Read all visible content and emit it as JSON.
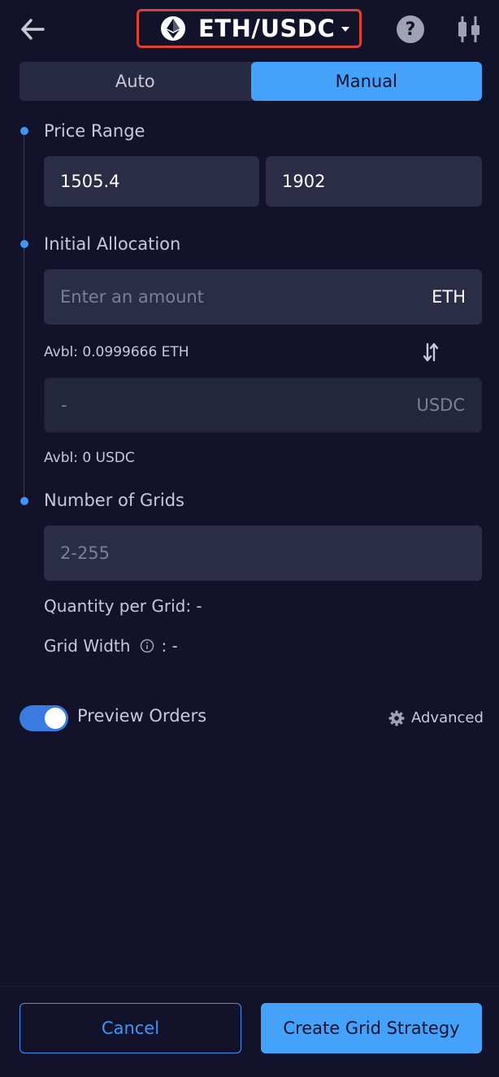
{
  "header": {
    "pair": "ETH/USDC",
    "back_icon": "arrow-left-icon",
    "help_glyph": "?",
    "chart_icon": "candlestick-icon"
  },
  "tabs": [
    {
      "label": "Auto",
      "active": false
    },
    {
      "label": "Manual",
      "active": true
    }
  ],
  "price_range": {
    "label": "Price Range",
    "lower": "1505.4",
    "upper": "1902"
  },
  "allocation": {
    "label": "Initial Allocation",
    "eth_placeholder": "Enter an amount",
    "eth_unit": "ETH",
    "eth_available": "Avbl: 0.0999666 ETH",
    "usdc_value": "-",
    "usdc_unit": "USDC",
    "usdc_available": "Avbl: 0 USDC"
  },
  "grids": {
    "label": "Number of Grids",
    "placeholder": "2-255",
    "quantity_per_grid": "Quantity per Grid: -",
    "grid_width_label": "Grid Width",
    "grid_width_value": ": -"
  },
  "preview": {
    "label": "Preview Orders",
    "enabled": true,
    "advanced_label": "Advanced"
  },
  "footer": {
    "cancel": "Cancel",
    "create": "Create Grid Strategy"
  },
  "colors": {
    "background": "#12132b",
    "accent": "#44a2fb",
    "highlight_border": "#e0402f"
  }
}
